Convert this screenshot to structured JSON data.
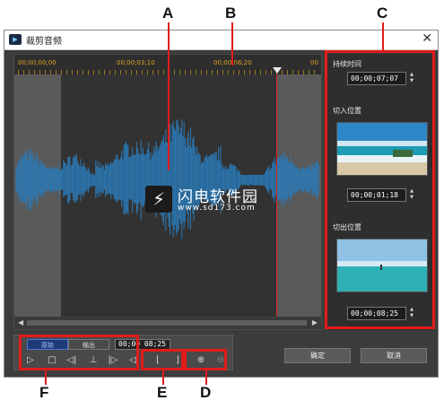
{
  "window": {
    "title": "裁剪音频",
    "close_icon": "close-icon",
    "app_icon": "app-icon"
  },
  "ruler": {
    "labels": [
      "00;00;00;00",
      "00;00;03;10",
      "00;00;06;20",
      "00"
    ]
  },
  "right_panel": {
    "duration_label": "持续时间",
    "duration_value": "00;00;07;07",
    "in_label": "切入位置",
    "in_value": "00;00;01;18",
    "out_label": "切出位置",
    "out_value": "00;00;08;25"
  },
  "controls": {
    "tab_original": "原始",
    "tab_output": "输出",
    "timecode": "00;00 08;25",
    "buttons": [
      "play-icon",
      "stop-icon",
      "previous-frame-icon",
      "mark-in-icon",
      "next-frame-icon",
      "volume-icon",
      "set-in-icon",
      "set-out-icon",
      "zoom-in-icon",
      "zoom-out-icon"
    ]
  },
  "footer": {
    "ok": "确定",
    "cancel": "取消"
  },
  "callouts": {
    "a": "A",
    "b": "B",
    "c": "C",
    "d": "D",
    "e": "E",
    "f": "F"
  },
  "watermark": {
    "name": "闪电软件园",
    "url": "www.sd173.com"
  },
  "colors": {
    "highlight": "#e11b1b",
    "waveform": "#2a7ab8",
    "ruler_text": "#e0a020",
    "tab_active": "#1e3a78"
  }
}
